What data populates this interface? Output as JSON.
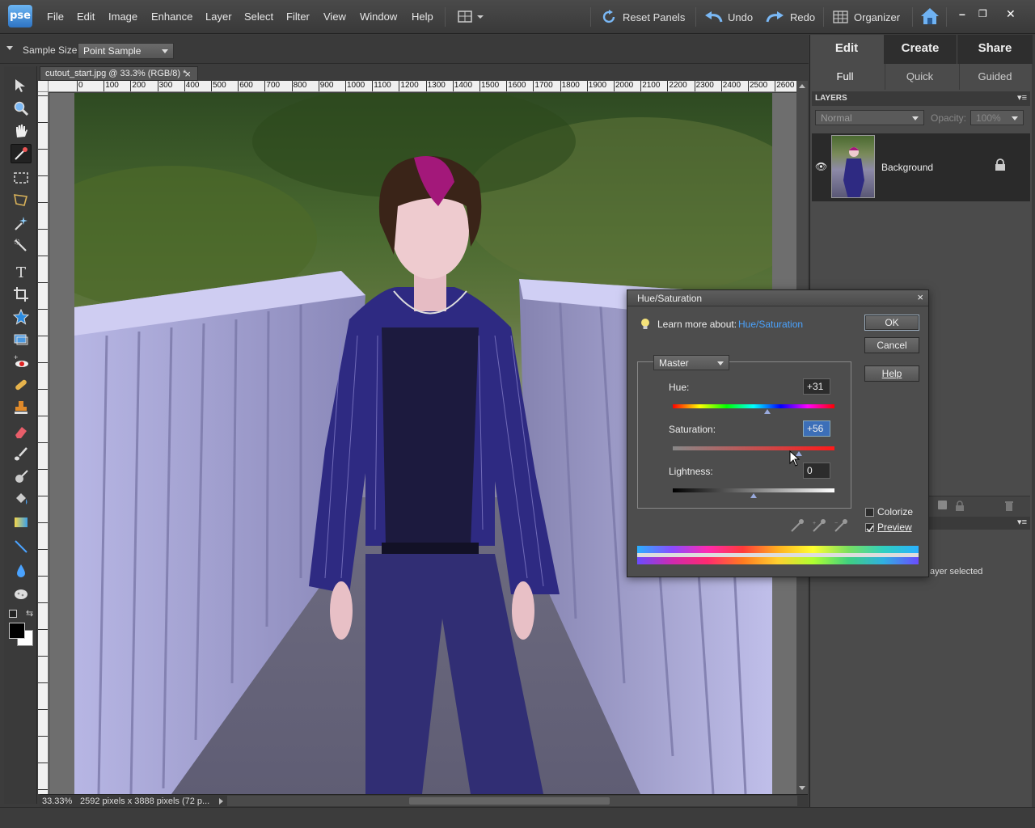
{
  "app": {
    "logo": "pse",
    "menu": [
      "File",
      "Edit",
      "Image",
      "Enhance",
      "Layer",
      "Select",
      "Filter",
      "View",
      "Window",
      "Help"
    ],
    "buttons": {
      "reset_panels": "Reset Panels",
      "undo": "Undo",
      "redo": "Redo",
      "organizer": "Organizer"
    },
    "window_controls": {
      "minimize": "–",
      "restore": "❐",
      "close": "✕"
    }
  },
  "options_bar": {
    "sample_size_label": "Sample Size:",
    "sample_size_value": "Point Sample"
  },
  "document": {
    "tab_title": "cutout_start.jpg @ 33.3% (RGB/8) *",
    "tab_close": "×",
    "ruler_labels": [
      "0",
      "100",
      "200",
      "300",
      "400",
      "500",
      "600",
      "700",
      "800",
      "900",
      "1000",
      "1100",
      "1200",
      "1300",
      "1400",
      "1500",
      "1600",
      "1700",
      "1800",
      "1900",
      "2000",
      "2100",
      "2200",
      "2300",
      "2400",
      "2500",
      "2600"
    ],
    "zoom": "33.33%",
    "info": "2592 pixels x 3888 pixels (72 p..."
  },
  "right_panel": {
    "mode_tabs": [
      "Edit",
      "Create",
      "Share"
    ],
    "sub_tabs": [
      "Full",
      "Quick",
      "Guided"
    ],
    "layers_title": "LAYERS",
    "blend_mode": "Normal",
    "opacity_label": "Opacity:",
    "opacity_value": "100%",
    "layer_name": "Background",
    "lower_panel_text": "ayer selected"
  },
  "dialog": {
    "title": "Hue/Saturation",
    "close": "×",
    "learn_more_prefix": "Learn more about:",
    "learn_more_link": "Hue/Saturation",
    "ok": "OK",
    "cancel": "Cancel",
    "help": "Help",
    "edit_channel": "Master",
    "hue_label": "Hue:",
    "hue_value": "+31",
    "saturation_label": "Saturation:",
    "saturation_value": "+56",
    "lightness_label": "Lightness:",
    "lightness_value": "0",
    "colorize_label": "Colorize",
    "colorize_checked": false,
    "preview_label": "Preview",
    "preview_checked": true,
    "hue_fraction": 0.586,
    "saturation_fraction": 0.78,
    "lightness_fraction": 0.5
  },
  "colors": {
    "accent_link": "#4aa3ff",
    "panel_bg": "#4b4b4b",
    "menubar_bg": "#3f3f3f"
  }
}
